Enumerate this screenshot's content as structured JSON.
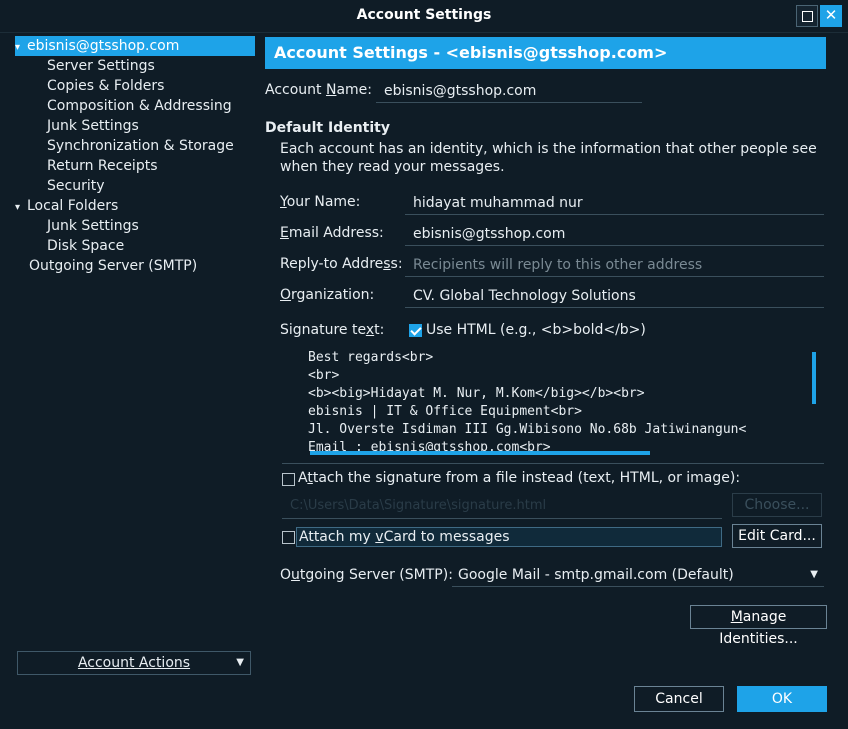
{
  "window": {
    "title": "Account Settings"
  },
  "tree": {
    "items": [
      {
        "label": "ebisnis@gtsshop.com",
        "arrow": "▾"
      },
      {
        "label": "Server Settings"
      },
      {
        "label": "Copies & Folders"
      },
      {
        "label": "Composition & Addressing"
      },
      {
        "label": "Junk Settings"
      },
      {
        "label": "Synchronization & Storage"
      },
      {
        "label": "Return Receipts"
      },
      {
        "label": "Security"
      },
      {
        "label": "Local Folders",
        "arrow": "▾"
      },
      {
        "label": "Junk Settings"
      },
      {
        "label": "Disk Space"
      },
      {
        "label": "Outgoing Server (SMTP)"
      }
    ],
    "account_actions": "Account Actions"
  },
  "panel": {
    "header": "Account Settings - <ebisnis@gtsshop.com>",
    "account_name_label_pre": "Account ",
    "account_name_label_u": "N",
    "account_name_label_post": "ame:",
    "account_name_value": "ebisnis@gtsshop.com",
    "default_identity_title": "Default Identity",
    "default_identity_desc": "Each account has an identity, which is the information that other people see when they read your messages.",
    "your_name_label_u": "Y",
    "your_name_label_post": "our Name:",
    "your_name_value": "hidayat muhammad nur",
    "email_label_u": "E",
    "email_label_post": "mail Address:",
    "email_value": "ebisnis@gtsshop.com",
    "replyto_label_pre": "Reply-to Addre",
    "replyto_label_u": "s",
    "replyto_label_post": "s:",
    "replyto_placeholder": "Recipients will reply to this other address",
    "org_label_u": "O",
    "org_label_post": "rganization:",
    "org_value": "CV. Global Technology Solutions",
    "sig_label_pre": "Signature te",
    "sig_label_u": "x",
    "sig_label_post": "t:",
    "use_html_label": "Use HTML (e.g., <b>bold</b>)",
    "use_html_checked": true,
    "signature_lines": [
      "Best regards<br>",
      "<br>",
      "<b><big>Hidayat M. Nur, M.Kom</big></b><br>",
      "ebisnis | IT & Office Equipment<br>",
      "Jl. Overste Isdiman III Gg.Wibisono No.68b Jatiwinangun<",
      "Email : ebisnis@gtsshop.com<br>"
    ],
    "attach_sig_label_pre": "A",
    "attach_sig_label_u": "t",
    "attach_sig_label_post": "tach the signature from a file instead (text, HTML, or image):",
    "attach_sig_path": "C:\\Users\\Data\\Signature\\signature.html",
    "choose_label": "Choose...",
    "vcard_label_pre": "Attach my ",
    "vcard_label_u": "v",
    "vcard_label_post": "Card to messages",
    "edit_card_label": "Edit Card...",
    "smtp_label_pre": "O",
    "smtp_label_u": "u",
    "smtp_label_post": "tgoing Server (SMTP):",
    "smtp_value": "Google Mail - smtp.gmail.com (Default)",
    "manage_identities_u": "M",
    "manage_identities_post": "anage Identities..."
  },
  "footer": {
    "cancel": "Cancel",
    "ok": "OK"
  },
  "colors": {
    "accent": "#1ea3e8",
    "background": "#0f1c26",
    "text": "#e8eef2"
  }
}
